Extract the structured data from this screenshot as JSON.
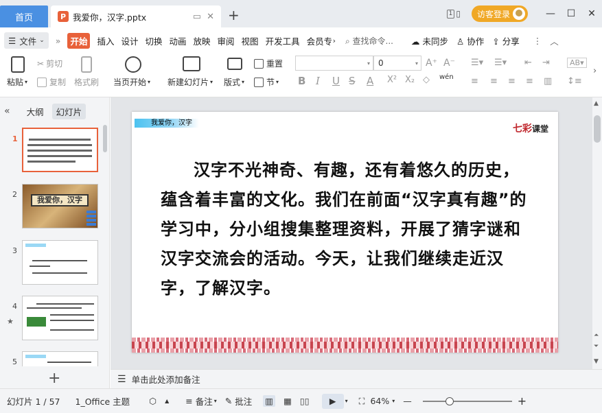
{
  "window": {
    "home_tab": "首页",
    "doc_tab_title": "我爱你，汉字.pptx",
    "new_tab_symbol": "+",
    "page_badge": "1",
    "login_label": "访客登录",
    "minimize": "—",
    "restore": "☐",
    "close": "✕"
  },
  "menu": {
    "file_label": "文件",
    "items": [
      "开始",
      "插入",
      "设计",
      "切换",
      "动画",
      "放映",
      "审阅",
      "视图",
      "开发工具",
      "会员专"
    ],
    "search_placeholder": "查找命令...",
    "sync_label": "未同步",
    "collab_label": "协作",
    "share_label": "分享"
  },
  "ribbon": {
    "paste": "粘贴",
    "cut": "剪切",
    "copy": "复制",
    "format_painter": "格式刷",
    "play_from_current": "当页开始",
    "new_slide": "新建幻灯片",
    "layout": "版式",
    "reset": "重置",
    "section": "节",
    "font_name_value": "",
    "font_size_value": "0",
    "bold": "B",
    "italic": "I",
    "underline": "U",
    "strike": "S",
    "font_color": "A",
    "superscript": "X²",
    "subscript": "X₂",
    "pinyin": "wén"
  },
  "left_pane": {
    "tab_outline": "大纲",
    "tab_slides": "幻灯片",
    "thumbnails": [
      {
        "num": "1",
        "selected": true
      },
      {
        "num": "2",
        "selected": false,
        "title": "我爱你，汉字"
      },
      {
        "num": "3",
        "selected": false
      },
      {
        "num": "4",
        "selected": false
      },
      {
        "num": "5",
        "selected": false
      }
    ],
    "add_symbol": "+"
  },
  "slide": {
    "tag": "我爱你，汉字",
    "logo_main": "七彩",
    "logo_sub": "课堂",
    "body": "汉字不光神奇、有趣，还有着悠久的历史，蕴含着丰富的文化。我们在前面“汉字真有趣”的学习中，分小组搜集整理资料，开展了猜字谜和汉字交流会的活动。今天，让我们继续走近汉字，了解汉字。"
  },
  "notes": {
    "placeholder": "单击此处添加备注"
  },
  "status": {
    "slide_counter": "幻灯片 1 / 57",
    "theme": "1_Office 主题",
    "notes_btn": "备注",
    "comment_btn": "批注",
    "zoom": "64%",
    "zoom_fraction": 0.3
  },
  "colors": {
    "accent": "#e8613a",
    "home_tab": "#4a90e2",
    "login": "#f0a826"
  }
}
